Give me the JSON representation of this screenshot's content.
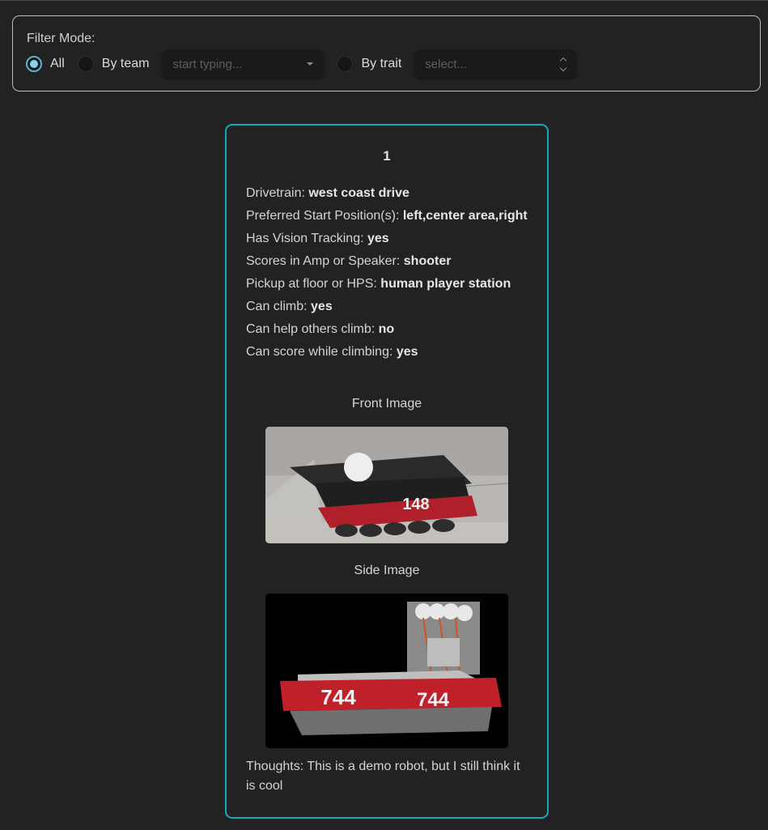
{
  "filter": {
    "title": "Filter Mode:",
    "options": [
      {
        "label": "All",
        "checked": true
      },
      {
        "label": "By team",
        "checked": false
      },
      {
        "label": "By trait",
        "checked": false
      }
    ],
    "team_select_placeholder": "start typing...",
    "trait_select_placeholder": "select..."
  },
  "card": {
    "number": "1",
    "traits": [
      {
        "label": "Drivetrain:",
        "value": "west coast drive"
      },
      {
        "label": "Preferred Start Position(s):",
        "value": "left,center area,right"
      },
      {
        "label": "Has Vision Tracking:",
        "value": "yes"
      },
      {
        "label": "Scores in Amp or Speaker:",
        "value": "shooter"
      },
      {
        "label": "Pickup at floor or HPS:",
        "value": "human player station"
      },
      {
        "label": "Can climb:",
        "value": "yes"
      },
      {
        "label": "Can help others climb:",
        "value": "no"
      },
      {
        "label": "Can score while climbing:",
        "value": "yes"
      }
    ],
    "front_image_caption": "Front Image",
    "front_robot_number": "148",
    "side_image_caption": "Side Image",
    "side_robot_number": "744",
    "thoughts": "Thoughts: This is a demo robot, but I still think it is cool"
  },
  "colors": {
    "accent": "#16a7b9",
    "radio_checked": "#7fd6ec",
    "background": "#222222",
    "bumper_red": "#c0202a"
  }
}
